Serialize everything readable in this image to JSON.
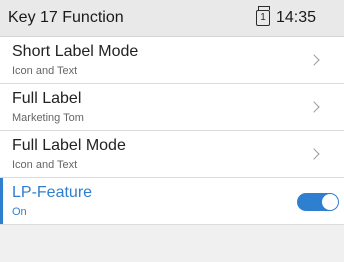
{
  "header": {
    "title": "Key 17 Function",
    "line_number": "1",
    "line_icon": "phone-line-icon",
    "time": "14:35"
  },
  "items": [
    {
      "label": "Short Label Mode",
      "sub": "Icon and Text",
      "control": "chevron"
    },
    {
      "label": "Full Label",
      "sub": "Marketing Tom",
      "control": "chevron"
    },
    {
      "label": "Full Label Mode",
      "sub": "Icon and Text",
      "control": "chevron"
    },
    {
      "label": "LP-Feature",
      "sub": "On",
      "control": "toggle",
      "toggle_on": true,
      "selected": true
    }
  ],
  "colors": {
    "accent": "#2f7fd0",
    "header_bg": "#e9e9e9"
  }
}
